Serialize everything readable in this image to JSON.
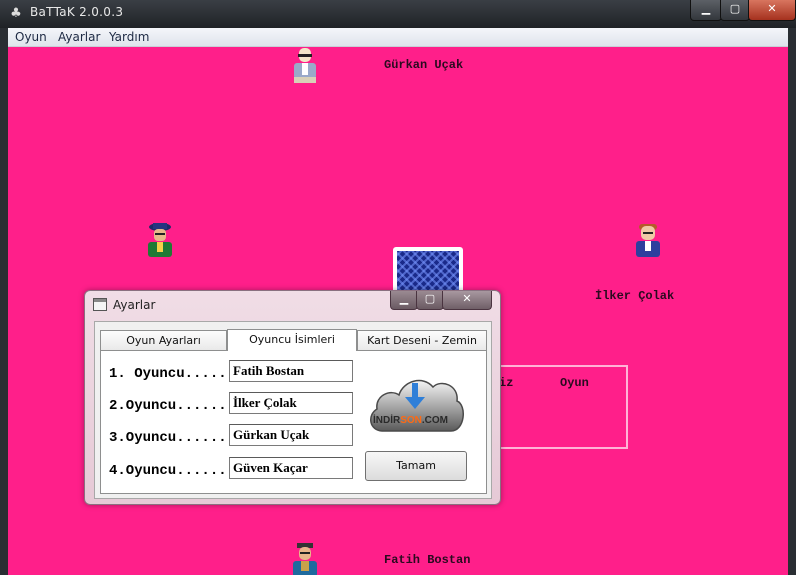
{
  "window": {
    "title": "BaTTaK  2.0.0.3"
  },
  "menu": [
    "Oyun",
    "Ayarlar",
    "Yardım"
  ],
  "players": {
    "top": "Gürkan Uçak",
    "right": "İlker Çolak",
    "bottom": "Fatih Bostan"
  },
  "score": {
    "label_left": "iz",
    "label_right": "Oyun"
  },
  "dialog": {
    "title": "Ayarlar",
    "tabs": [
      "Oyun Ayarları",
      "Oyuncu İsimleri",
      "Kart Deseni - Zemin"
    ],
    "active_tab": 1,
    "rows": [
      {
        "label": "1. Oyuncu.....",
        "value": "Fatih Bostan"
      },
      {
        "label": "2.Oyuncu.......",
        "value": "İlker Çolak"
      },
      {
        "label": "3.Oyuncu.......",
        "value": "Gürkan Uçak"
      },
      {
        "label": "4.Oyuncu.......",
        "value": "Güven Kaçar"
      }
    ],
    "logo_text": {
      "part1": "İNDİR",
      "part2": "SON",
      "part3": ".COM"
    },
    "ok_label": "Tamam"
  },
  "colors": {
    "table": "#ff1f8a",
    "logo_orange": "#ff6a13",
    "logo_arrow": "#2f7fd8"
  }
}
